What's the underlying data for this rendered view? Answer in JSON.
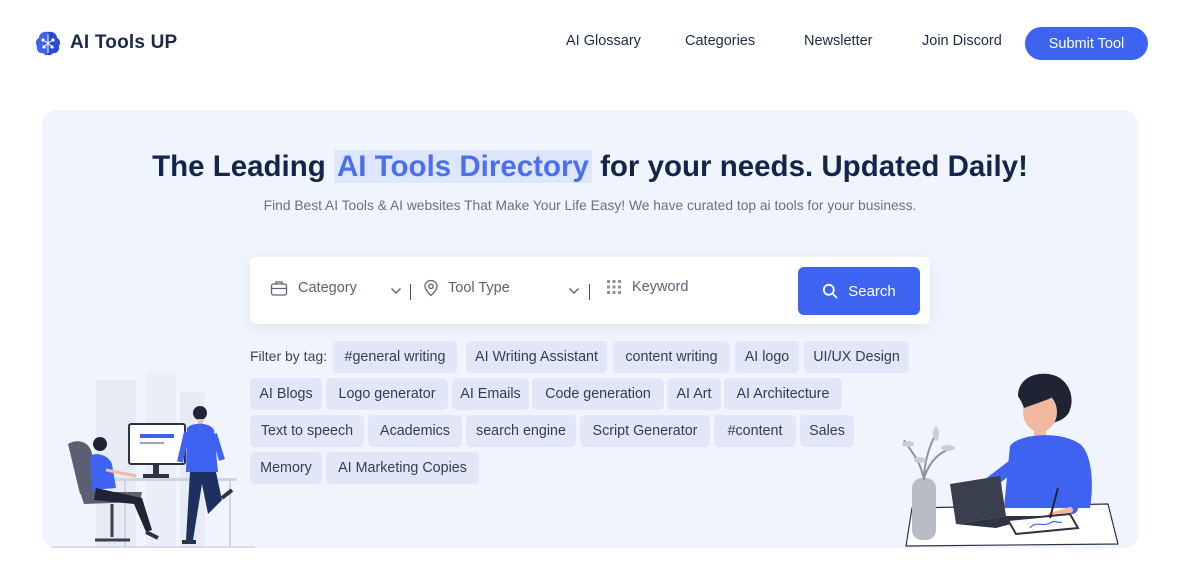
{
  "brand": {
    "name": "AI Tools UP",
    "logo_icon": "brain-icon",
    "accent": "#3d63f0"
  },
  "nav": {
    "items": [
      {
        "label": "AI Glossary"
      },
      {
        "label": "Categories"
      },
      {
        "label": "Newsletter"
      },
      {
        "label": "Join Discord"
      }
    ],
    "submit_label": "Submit Tool"
  },
  "hero": {
    "title_before": "The Leading ",
    "title_highlight": "AI Tools Directory",
    "title_after": " for your needs. Updated Daily!",
    "subtitle": "Find Best AI Tools & AI websites That Make Your Life Easy! We have curated top ai tools for your business."
  },
  "search": {
    "category_placeholder": "Category",
    "tool_type_placeholder": "Tool Type",
    "keyword_placeholder": "Keyword",
    "button_label": "Search"
  },
  "filters": {
    "label": "Filter by tag:",
    "tags": [
      "#general writing",
      "AI Writing Assistant",
      "content writing",
      "AI logo",
      "UI/UX Design",
      "AI Blogs",
      "Logo generator",
      "AI Emails",
      "Code generation",
      "AI Art",
      "AI Architecture",
      "Text to speech",
      "Academics",
      "search engine",
      "Script Generator",
      "#content",
      "Sales",
      "Memory",
      "AI Marketing Copies"
    ]
  }
}
